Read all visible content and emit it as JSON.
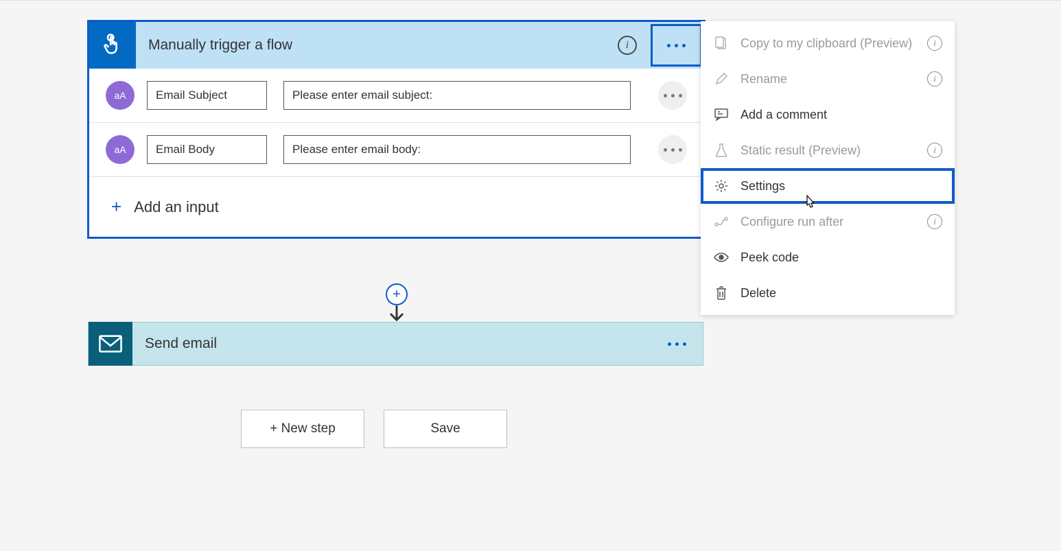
{
  "trigger": {
    "title": "Manually trigger a flow",
    "inputs": [
      {
        "name": "Email Subject",
        "placeholder": "Please enter email subject:",
        "icon": "aA"
      },
      {
        "name": "Email Body",
        "placeholder": "Please enter email body:",
        "icon": "aA"
      }
    ],
    "add_input_label": "Add an input"
  },
  "action": {
    "title": "Send email"
  },
  "footer": {
    "new_step": "+ New step",
    "save": "Save"
  },
  "menu": {
    "copy": "Copy to my clipboard (Preview)",
    "rename": "Rename",
    "comment": "Add a comment",
    "static": "Static result (Preview)",
    "settings": "Settings",
    "run_after": "Configure run after",
    "peek": "Peek code",
    "delete": "Delete"
  }
}
